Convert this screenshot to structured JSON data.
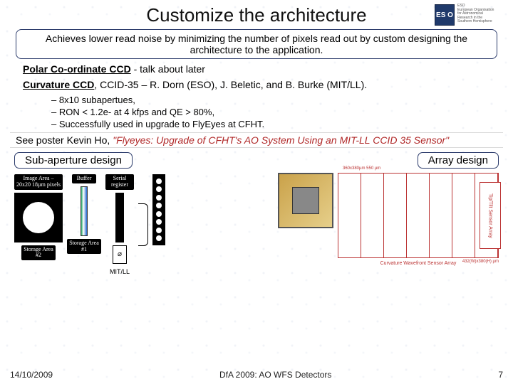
{
  "title": "Customize the architecture",
  "logo": {
    "abbr": "ES\nO",
    "org_line1": "ESO",
    "org_line2": "European Organisation",
    "org_line3": "for Astronomical",
    "org_line4": "Research in the",
    "org_line5": "Southern Hemisphere"
  },
  "callout": "Achieves lower read noise by minimizing the number of pixels read out by custom designing the architecture to the application.",
  "line_polar_prefix": "Polar Co-ordinate CCD",
  "line_polar_rest": " - talk about later",
  "line_curv_prefix": "Curvature CCD",
  "line_curv_rest": ", CCID-35 – R. Dorn (ESO), J. Beletic, and B. Burke (MIT/LL).",
  "bullets": [
    "8x10 subapertues,",
    "RON < 1.2e- at 4 kfps and QE > 80%,",
    "Successfully used in upgrade to FlyEyes at CFHT."
  ],
  "poster_lead": "See poster Kevin Ho, ",
  "poster_title": "\"Flyeyes: Upgrade of CFHT's AO System Using an MIT-LL CCID 35 Sensor\"",
  "panel_left_title": "Sub-aperture design",
  "panel_right_title": "Array design",
  "diagram": {
    "image_area": "Image Area – 20x20 18µm pixels",
    "buffer": "Buffer",
    "serial": "Serial register",
    "storage1": "Storage Area #1",
    "storage2": "Storage Area #2",
    "mitll": "MIT/LL"
  },
  "array": {
    "top_dims": "360x380µm 550 µm",
    "right_dims": "432(W)x380(H) µm",
    "side_label": "Tip/Tilt Sensor Array",
    "caption": "Curvature Wavefront Sensor Array"
  },
  "footer": {
    "date": "14/10/2009",
    "center": "DfA 2009: AO WFS Detectors",
    "page": "7"
  }
}
